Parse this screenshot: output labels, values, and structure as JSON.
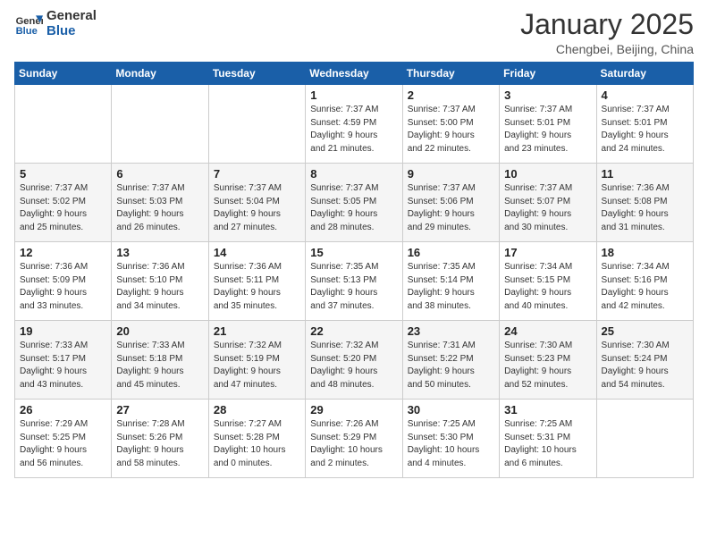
{
  "header": {
    "logo_general": "General",
    "logo_blue": "Blue",
    "month_year": "January 2025",
    "location": "Chengbei, Beijing, China"
  },
  "weekdays": [
    "Sunday",
    "Monday",
    "Tuesday",
    "Wednesday",
    "Thursday",
    "Friday",
    "Saturday"
  ],
  "weeks": [
    [
      {
        "day": "",
        "info": ""
      },
      {
        "day": "",
        "info": ""
      },
      {
        "day": "",
        "info": ""
      },
      {
        "day": "1",
        "info": "Sunrise: 7:37 AM\nSunset: 4:59 PM\nDaylight: 9 hours\nand 21 minutes."
      },
      {
        "day": "2",
        "info": "Sunrise: 7:37 AM\nSunset: 5:00 PM\nDaylight: 9 hours\nand 22 minutes."
      },
      {
        "day": "3",
        "info": "Sunrise: 7:37 AM\nSunset: 5:01 PM\nDaylight: 9 hours\nand 23 minutes."
      },
      {
        "day": "4",
        "info": "Sunrise: 7:37 AM\nSunset: 5:01 PM\nDaylight: 9 hours\nand 24 minutes."
      }
    ],
    [
      {
        "day": "5",
        "info": "Sunrise: 7:37 AM\nSunset: 5:02 PM\nDaylight: 9 hours\nand 25 minutes."
      },
      {
        "day": "6",
        "info": "Sunrise: 7:37 AM\nSunset: 5:03 PM\nDaylight: 9 hours\nand 26 minutes."
      },
      {
        "day": "7",
        "info": "Sunrise: 7:37 AM\nSunset: 5:04 PM\nDaylight: 9 hours\nand 27 minutes."
      },
      {
        "day": "8",
        "info": "Sunrise: 7:37 AM\nSunset: 5:05 PM\nDaylight: 9 hours\nand 28 minutes."
      },
      {
        "day": "9",
        "info": "Sunrise: 7:37 AM\nSunset: 5:06 PM\nDaylight: 9 hours\nand 29 minutes."
      },
      {
        "day": "10",
        "info": "Sunrise: 7:37 AM\nSunset: 5:07 PM\nDaylight: 9 hours\nand 30 minutes."
      },
      {
        "day": "11",
        "info": "Sunrise: 7:36 AM\nSunset: 5:08 PM\nDaylight: 9 hours\nand 31 minutes."
      }
    ],
    [
      {
        "day": "12",
        "info": "Sunrise: 7:36 AM\nSunset: 5:09 PM\nDaylight: 9 hours\nand 33 minutes."
      },
      {
        "day": "13",
        "info": "Sunrise: 7:36 AM\nSunset: 5:10 PM\nDaylight: 9 hours\nand 34 minutes."
      },
      {
        "day": "14",
        "info": "Sunrise: 7:36 AM\nSunset: 5:11 PM\nDaylight: 9 hours\nand 35 minutes."
      },
      {
        "day": "15",
        "info": "Sunrise: 7:35 AM\nSunset: 5:13 PM\nDaylight: 9 hours\nand 37 minutes."
      },
      {
        "day": "16",
        "info": "Sunrise: 7:35 AM\nSunset: 5:14 PM\nDaylight: 9 hours\nand 38 minutes."
      },
      {
        "day": "17",
        "info": "Sunrise: 7:34 AM\nSunset: 5:15 PM\nDaylight: 9 hours\nand 40 minutes."
      },
      {
        "day": "18",
        "info": "Sunrise: 7:34 AM\nSunset: 5:16 PM\nDaylight: 9 hours\nand 42 minutes."
      }
    ],
    [
      {
        "day": "19",
        "info": "Sunrise: 7:33 AM\nSunset: 5:17 PM\nDaylight: 9 hours\nand 43 minutes."
      },
      {
        "day": "20",
        "info": "Sunrise: 7:33 AM\nSunset: 5:18 PM\nDaylight: 9 hours\nand 45 minutes."
      },
      {
        "day": "21",
        "info": "Sunrise: 7:32 AM\nSunset: 5:19 PM\nDaylight: 9 hours\nand 47 minutes."
      },
      {
        "day": "22",
        "info": "Sunrise: 7:32 AM\nSunset: 5:20 PM\nDaylight: 9 hours\nand 48 minutes."
      },
      {
        "day": "23",
        "info": "Sunrise: 7:31 AM\nSunset: 5:22 PM\nDaylight: 9 hours\nand 50 minutes."
      },
      {
        "day": "24",
        "info": "Sunrise: 7:30 AM\nSunset: 5:23 PM\nDaylight: 9 hours\nand 52 minutes."
      },
      {
        "day": "25",
        "info": "Sunrise: 7:30 AM\nSunset: 5:24 PM\nDaylight: 9 hours\nand 54 minutes."
      }
    ],
    [
      {
        "day": "26",
        "info": "Sunrise: 7:29 AM\nSunset: 5:25 PM\nDaylight: 9 hours\nand 56 minutes."
      },
      {
        "day": "27",
        "info": "Sunrise: 7:28 AM\nSunset: 5:26 PM\nDaylight: 9 hours\nand 58 minutes."
      },
      {
        "day": "28",
        "info": "Sunrise: 7:27 AM\nSunset: 5:28 PM\nDaylight: 10 hours\nand 0 minutes."
      },
      {
        "day": "29",
        "info": "Sunrise: 7:26 AM\nSunset: 5:29 PM\nDaylight: 10 hours\nand 2 minutes."
      },
      {
        "day": "30",
        "info": "Sunrise: 7:25 AM\nSunset: 5:30 PM\nDaylight: 10 hours\nand 4 minutes."
      },
      {
        "day": "31",
        "info": "Sunrise: 7:25 AM\nSunset: 5:31 PM\nDaylight: 10 hours\nand 6 minutes."
      },
      {
        "day": "",
        "info": ""
      }
    ]
  ]
}
